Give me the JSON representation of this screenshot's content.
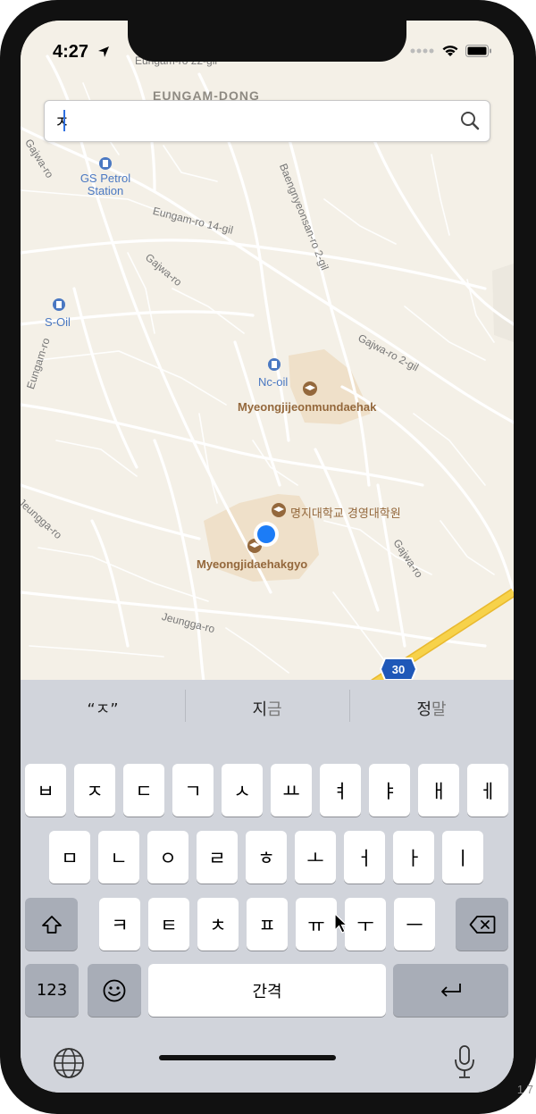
{
  "status_bar": {
    "time": "4:27"
  },
  "search": {
    "value": "ㅈ"
  },
  "map": {
    "street_labels": [
      "Eungam-ro 22-gil",
      "EUNGAM-DONG",
      "Gajwa-ro",
      "Baengnyeonsan-ro 2-gil",
      "Eungam-ro 14-gil",
      "Gajwa-ro",
      "Gajwa-ro 2-gil",
      "Eungam-ro",
      "Jeungga-ro",
      "Gajwa-ro",
      "Jeungga-ro"
    ],
    "pois": [
      {
        "name": "GS Petrol Station",
        "type": "fuel"
      },
      {
        "name": "S-Oil",
        "type": "fuel"
      },
      {
        "name": "Nc-oil",
        "type": "fuel"
      },
      {
        "name": "Myeongjijeonmundaehak",
        "type": "school"
      },
      {
        "name": "명지대학교 경영대학원",
        "type": "school"
      },
      {
        "name": "Myeongjidaehakgyo",
        "type": "school"
      }
    ],
    "route_shield": "30"
  },
  "keyboard": {
    "suggestions": [
      {
        "main": "“ㅈ”",
        "dim": ""
      },
      {
        "main": "지",
        "dim": "금"
      },
      {
        "main": "정",
        "dim": "말"
      }
    ],
    "row1": [
      "ㅂ",
      "ㅈ",
      "ㄷ",
      "ㄱ",
      "ㅅ",
      "ㅛ",
      "ㅕ",
      "ㅑ",
      "ㅐ",
      "ㅔ"
    ],
    "row2": [
      "ㅁ",
      "ㄴ",
      "ㅇ",
      "ㄹ",
      "ㅎ",
      "ㅗ",
      "ㅓ",
      "ㅏ",
      "ㅣ"
    ],
    "row3": [
      "ㅋ",
      "ㅌ",
      "ㅊ",
      "ㅍ",
      "ㅠ",
      "ㅜ",
      "ㅡ"
    ],
    "numbers_label": "123",
    "space_label": "간격"
  },
  "footer": {
    "corner_text": "1 7"
  },
  "colors": {
    "location": "#1c7cf6",
    "road": "#f7c93a",
    "poi_brown": "#94683c",
    "poi_blue": "#4a78c2"
  }
}
